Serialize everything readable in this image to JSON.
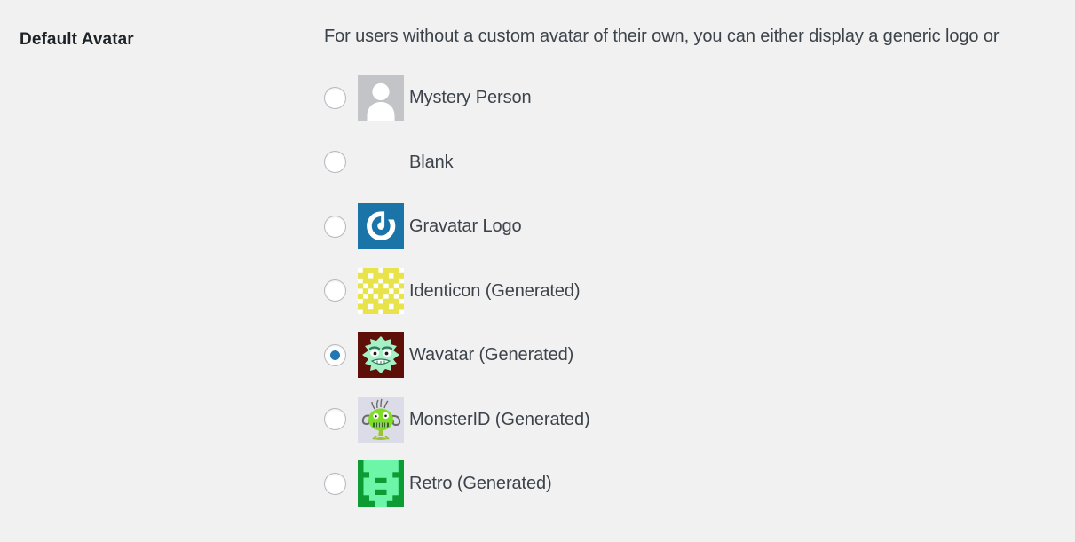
{
  "section": {
    "heading": "Default Avatar",
    "description": "For users without a custom avatar of their own, you can either display a generic logo or"
  },
  "colors": {
    "page_background": "#f1f1f1",
    "heading_text": "#1d2327",
    "body_text": "#3c434a",
    "radio_border": "#b4b9be",
    "radio_selected_dot": "#2077b3",
    "mystery_person_bg": "#c3c4c7",
    "gravatar_blue": "#1a74a8",
    "identicon_yellow": "#e8e34a",
    "wavatar_bg": "#5e1008",
    "wavatar_face": "#a6f0c6",
    "monsterid_bg": "#dcdce8",
    "monsterid_green": "#7fdd28",
    "retro_dark_green": "#0d9b33",
    "retro_light_green": "#6df5a8"
  },
  "avatar_options": [
    {
      "id": "mystery-person",
      "label": "Mystery Person",
      "icon": "mystery-person-avatar",
      "selected": false,
      "has_image": true
    },
    {
      "id": "blank",
      "label": "Blank",
      "icon": "blank-avatar",
      "selected": false,
      "has_image": false
    },
    {
      "id": "gravatar-logo",
      "label": "Gravatar Logo",
      "icon": "gravatar-logo-avatar",
      "selected": false,
      "has_image": true
    },
    {
      "id": "identicon",
      "label": "Identicon (Generated)",
      "icon": "identicon-avatar",
      "selected": false,
      "has_image": true
    },
    {
      "id": "wavatar",
      "label": "Wavatar (Generated)",
      "icon": "wavatar-avatar",
      "selected": true,
      "has_image": true
    },
    {
      "id": "monsterid",
      "label": "MonsterID (Generated)",
      "icon": "monsterid-avatar",
      "selected": false,
      "has_image": true
    },
    {
      "id": "retro",
      "label": "Retro (Generated)",
      "icon": "retro-avatar",
      "selected": false,
      "has_image": true
    }
  ]
}
